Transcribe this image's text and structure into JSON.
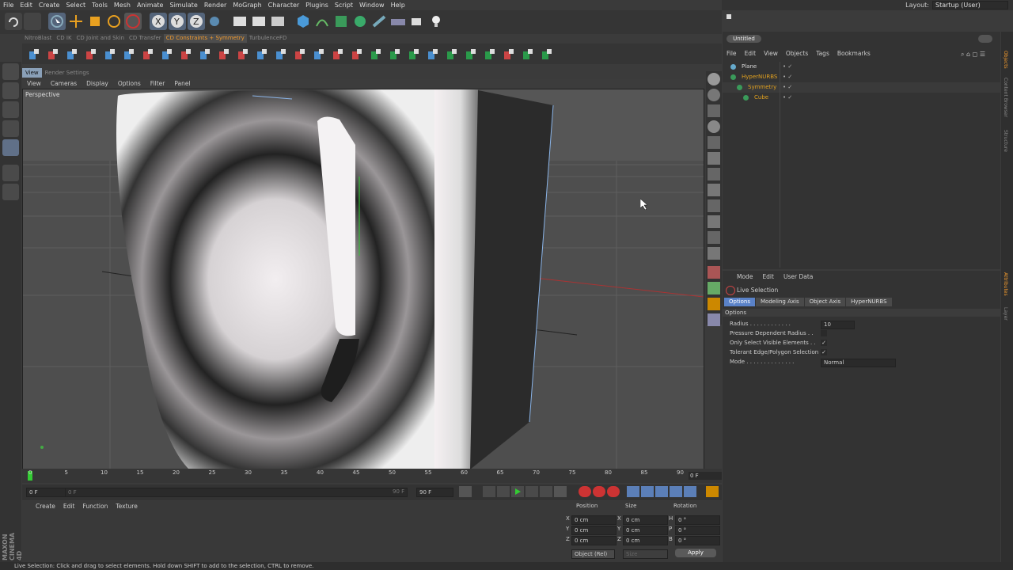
{
  "menu": [
    "File",
    "Edit",
    "Create",
    "Select",
    "Tools",
    "Mesh",
    "Animate",
    "Simulate",
    "Render",
    "MoGraph",
    "Character",
    "Plugins",
    "Script",
    "Window",
    "Help"
  ],
  "layout": {
    "label": "Layout:",
    "value": "Startup (User)"
  },
  "layer_tabs": [
    "NitroBlast",
    "CD IK",
    "CD Joint and Skin",
    "CD Transfer",
    "CD Constraints + Symmetry",
    "TurbulenceFD"
  ],
  "active_layer_tab": "CD Constraints + Symmetry",
  "view_tabs": [
    "View",
    "Render Settings"
  ],
  "viewport": {
    "menu": [
      "View",
      "Cameras",
      "Display",
      "Options",
      "Filter",
      "Panel"
    ],
    "label": "Perspective"
  },
  "timeline": {
    "ticks": [
      "0",
      "5",
      "10",
      "15",
      "20",
      "25",
      "30",
      "35",
      "40",
      "45",
      "50",
      "55",
      "60",
      "65",
      "70",
      "75",
      "80",
      "85",
      "90"
    ],
    "current": "0 F",
    "start": "0 F",
    "start2": "0 F",
    "end": "90 F",
    "end2": "90 F"
  },
  "material": {
    "menu": [
      "Create",
      "Edit",
      "Function",
      "Texture"
    ]
  },
  "coords": {
    "headers": [
      "Position",
      "Size",
      "Rotation"
    ],
    "rows": [
      {
        "a": "X",
        "pos": "0 cm",
        "b": "X",
        "size": "0 cm",
        "c": "H",
        "rot": "0 °"
      },
      {
        "a": "Y",
        "pos": "0 cm",
        "b": "Y",
        "size": "0 cm",
        "c": "P",
        "rot": "0 °"
      },
      {
        "a": "Z",
        "pos": "0 cm",
        "b": "Z",
        "size": "0 cm",
        "c": "B",
        "rot": "0 °"
      }
    ],
    "mode": "Object (Rel)",
    "size_mode": "Size",
    "apply": "Apply"
  },
  "status": "Live Selection: Click and drag to select elements. Hold down SHIFT to add to the selection, CTRL to remove.",
  "object_manager": {
    "title": "Untitled",
    "menu": [
      "File",
      "Edit",
      "View",
      "Objects",
      "Tags",
      "Bookmarks"
    ],
    "objects": [
      {
        "name": "Plane",
        "color": "#d8d8d8"
      },
      {
        "name": "HyperNURBS",
        "color": "#e0a020"
      },
      {
        "name": "Symmetry",
        "color": "#e0a020"
      },
      {
        "name": "Cube",
        "color": "#e0a020"
      }
    ]
  },
  "attributes": {
    "menu": [
      "Mode",
      "Edit",
      "User Data"
    ],
    "tool": "Live Selection",
    "tabs": [
      "Options",
      "Modeling Axis",
      "Object Axis",
      "HyperNURBS"
    ],
    "section": "Options",
    "props": [
      {
        "label": "Radius . . . . . . . . . . . .",
        "value": "10"
      },
      {
        "label": "Pressure Dependent Radius . .",
        "value": ""
      },
      {
        "label": "Only Select Visible Elements . .",
        "value": "✓"
      },
      {
        "label": "Tolerant Edge/Polygon Selection",
        "value": "✓"
      },
      {
        "label": "Mode . . . . . . . . . . . . . .",
        "value": "Normal"
      }
    ]
  },
  "side_tabs": [
    "Objects",
    "Content Browser",
    "Structure"
  ],
  "side_tabs2": [
    "Attributes",
    "Layer"
  ],
  "logo": "MAXON CINEMA 4D"
}
